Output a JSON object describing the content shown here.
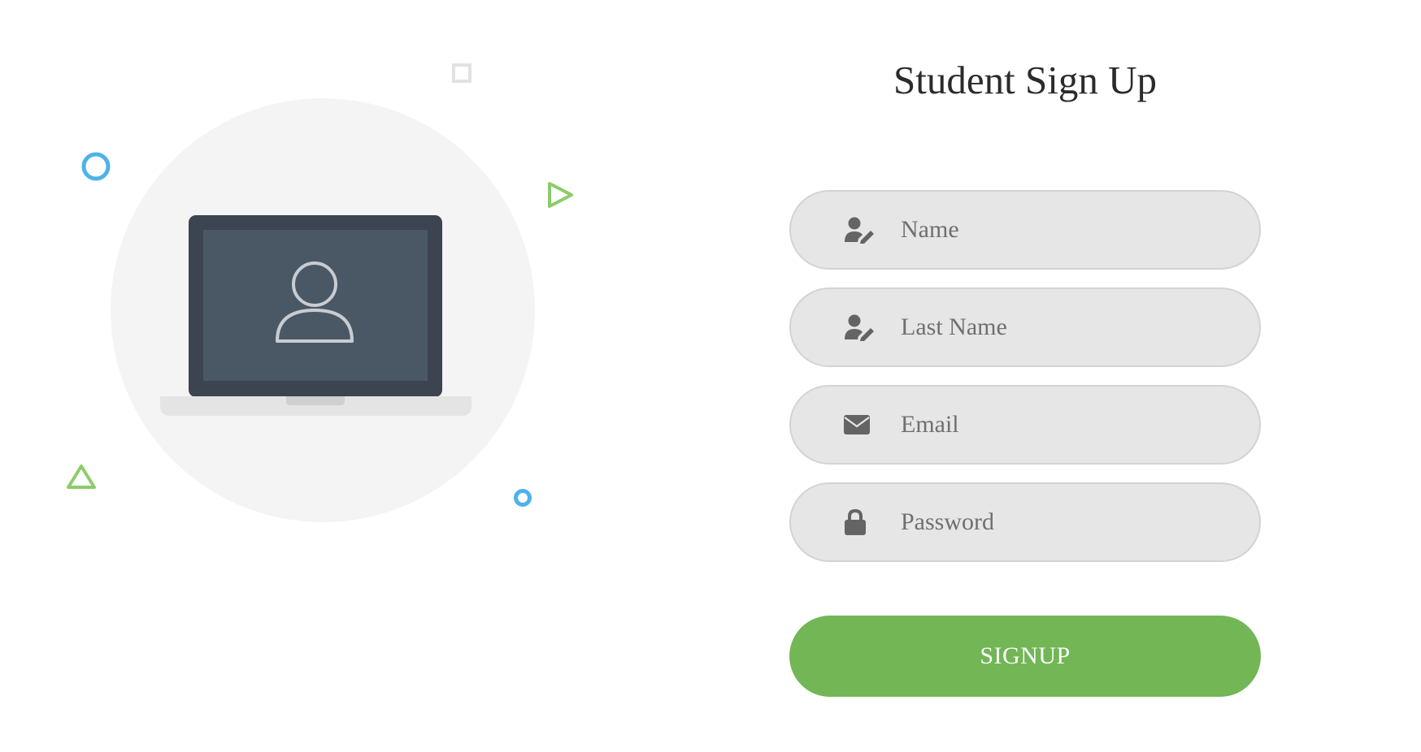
{
  "form": {
    "title": "Student Sign Up",
    "fields": [
      {
        "icon": "user-edit-icon",
        "placeholder": "Name",
        "value": ""
      },
      {
        "icon": "user-edit-icon",
        "placeholder": "Last Name",
        "value": ""
      },
      {
        "icon": "envelope-icon",
        "placeholder": "Email",
        "value": ""
      },
      {
        "icon": "lock-icon",
        "placeholder": "Password",
        "value": ""
      }
    ],
    "submit_label": "SIGNUP"
  },
  "colors": {
    "accent_green": "#72b656",
    "decoration_blue": "#4db2ea",
    "decoration_green": "#8dcb6a",
    "field_background": "#e6e6e6",
    "laptop_frame": "#3b4450",
    "laptop_screen": "#4a5866"
  },
  "illustration": {
    "icon": "laptop-user-icon"
  }
}
